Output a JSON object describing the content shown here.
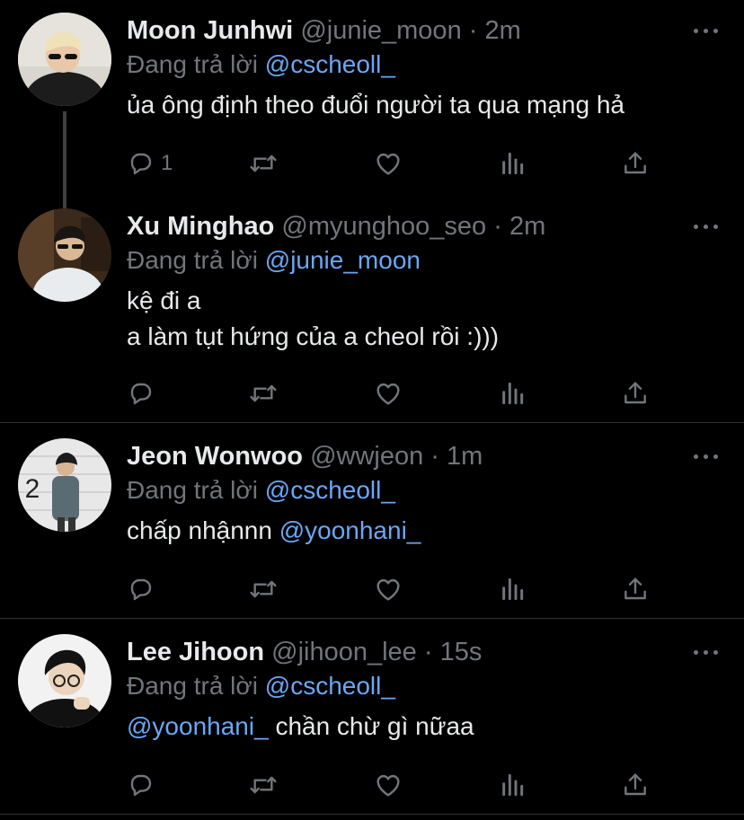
{
  "reply_prefix": "Đang trả lời",
  "tweets": [
    {
      "name": "Moon Junhwi",
      "handle": "@junie_moon",
      "time": "2m",
      "reply_to": "@cscheoll_",
      "lines": [
        "ủa ông định theo đuổi người ta qua mạng hả"
      ],
      "reply_count": "1"
    },
    {
      "name": "Xu Minghao",
      "handle": "@myunghoo_seo",
      "time": "2m",
      "reply_to": "@junie_moon",
      "lines": [
        "kệ đi a",
        "a làm tụt hứng của a cheol rồi :)))"
      ],
      "reply_count": ""
    },
    {
      "name": "Jeon Wonwoo",
      "handle": "@wwjeon",
      "time": "1m",
      "reply_to": "@cscheoll_",
      "body_text": "chấp nhậnnn",
      "body_mention": "@yoonhani_",
      "reply_count": ""
    },
    {
      "name": "Lee Jihoon",
      "handle": "@jihoon_lee",
      "time": "15s",
      "reply_to": "@cscheoll_",
      "body_mention": "@yoonhani_",
      "body_text": "chần chừ gì nữaa",
      "reply_count": ""
    }
  ],
  "avatar_2_badge": "2",
  "colors": {
    "background": "#000000",
    "mention": "#6ba7f5",
    "muted": "#71767b",
    "divider": "#2f3336"
  },
  "icons": [
    "reply-icon",
    "retweet-icon",
    "like-icon",
    "views-icon",
    "share-icon",
    "more-icon"
  ]
}
